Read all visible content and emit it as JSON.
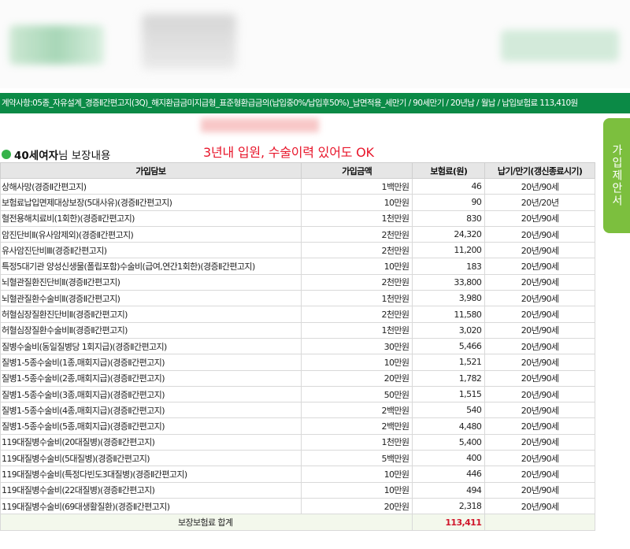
{
  "contract_summary": "계약사항:05종_자유설계_경증Ⅱ간편고지(3Q)_해지환급금미지급형_표준형환급금의(납입중0%/납입후50%)_납면적용_세만기 / 90세만기 / 20년납 / 월납 / 납입보험료 113,410원",
  "side_tab": "가입제안서",
  "section": {
    "title_bold": "40세여자",
    "title_light": "님 보장내용"
  },
  "note": "3년내 입원, 수술이력 있어도 OK",
  "table": {
    "headers": [
      "가입담보",
      "가입금액",
      "보험료(원)",
      "납기/만기(갱신종료시기)"
    ],
    "rows": [
      [
        "상해사망(경증Ⅱ간편고지)",
        "1백만원",
        "46",
        "20년/90세"
      ],
      [
        "보험료납입면제대상보장(5대사유)(경증Ⅱ간편고지)",
        "10만원",
        "90",
        "20년/20년"
      ],
      [
        "혈전용해치료비(1회한)(경증Ⅱ간편고지)",
        "1천만원",
        "830",
        "20년/90세"
      ],
      [
        "암진단비Ⅱ(유사암제외)(경증Ⅱ간편고지)",
        "2천만원",
        "24,320",
        "20년/90세"
      ],
      [
        "유사암진단비Ⅲ(경증Ⅱ간편고지)",
        "2천만원",
        "11,200",
        "20년/90세"
      ],
      [
        "특정5대기관 양성신생물(폴립포함)수술비(급여,연간1회한)(경증Ⅱ간편고지)",
        "10만원",
        "183",
        "20년/90세"
      ],
      [
        "뇌혈관질환진단비Ⅱ(경증Ⅱ간편고지)",
        "2천만원",
        "33,800",
        "20년/90세"
      ],
      [
        "뇌혈관질환수술비Ⅱ(경증Ⅱ간편고지)",
        "1천만원",
        "3,980",
        "20년/90세"
      ],
      [
        "허혈심장질환진단비Ⅱ(경증Ⅱ간편고지)",
        "2천만원",
        "11,580",
        "20년/90세"
      ],
      [
        "허혈심장질환수술비Ⅱ(경증Ⅱ간편고지)",
        "1천만원",
        "3,020",
        "20년/90세"
      ],
      [
        "질병수술비(동일질병당 1회지급)(경증Ⅱ간편고지)",
        "30만원",
        "5,466",
        "20년/90세"
      ],
      [
        "질병1-5종수술비(1종,매회지급)(경증Ⅱ간편고지)",
        "10만원",
        "1,521",
        "20년/90세"
      ],
      [
        "질병1-5종수술비(2종,매회지급)(경증Ⅱ간편고지)",
        "20만원",
        "1,782",
        "20년/90세"
      ],
      [
        "질병1-5종수술비(3종,매회지급)(경증Ⅱ간편고지)",
        "50만원",
        "1,515",
        "20년/90세"
      ],
      [
        "질병1-5종수술비(4종,매회지급)(경증Ⅱ간편고지)",
        "2백만원",
        "540",
        "20년/90세"
      ],
      [
        "질병1-5종수술비(5종,매회지급)(경증Ⅱ간편고지)",
        "2백만원",
        "4,480",
        "20년/90세"
      ],
      [
        "119대질병수술비(20대질병)(경증Ⅱ간편고지)",
        "1천만원",
        "5,400",
        "20년/90세"
      ],
      [
        "119대질병수술비(5대질병)(경증Ⅱ간편고지)",
        "5백만원",
        "400",
        "20년/90세"
      ],
      [
        "119대질병수술비(특정다빈도3대질병)(경증Ⅱ간편고지)",
        "10만원",
        "446",
        "20년/90세"
      ],
      [
        "119대질병수술비(22대질병)(경증Ⅱ간편고지)",
        "10만원",
        "494",
        "20년/90세"
      ],
      [
        "119대질병수술비(69대생활질환)(경증Ⅱ간편고지)",
        "20만원",
        "2,318",
        "20년/90세"
      ]
    ],
    "total_label": "보장보험료 합계",
    "total_value": "113,411"
  }
}
